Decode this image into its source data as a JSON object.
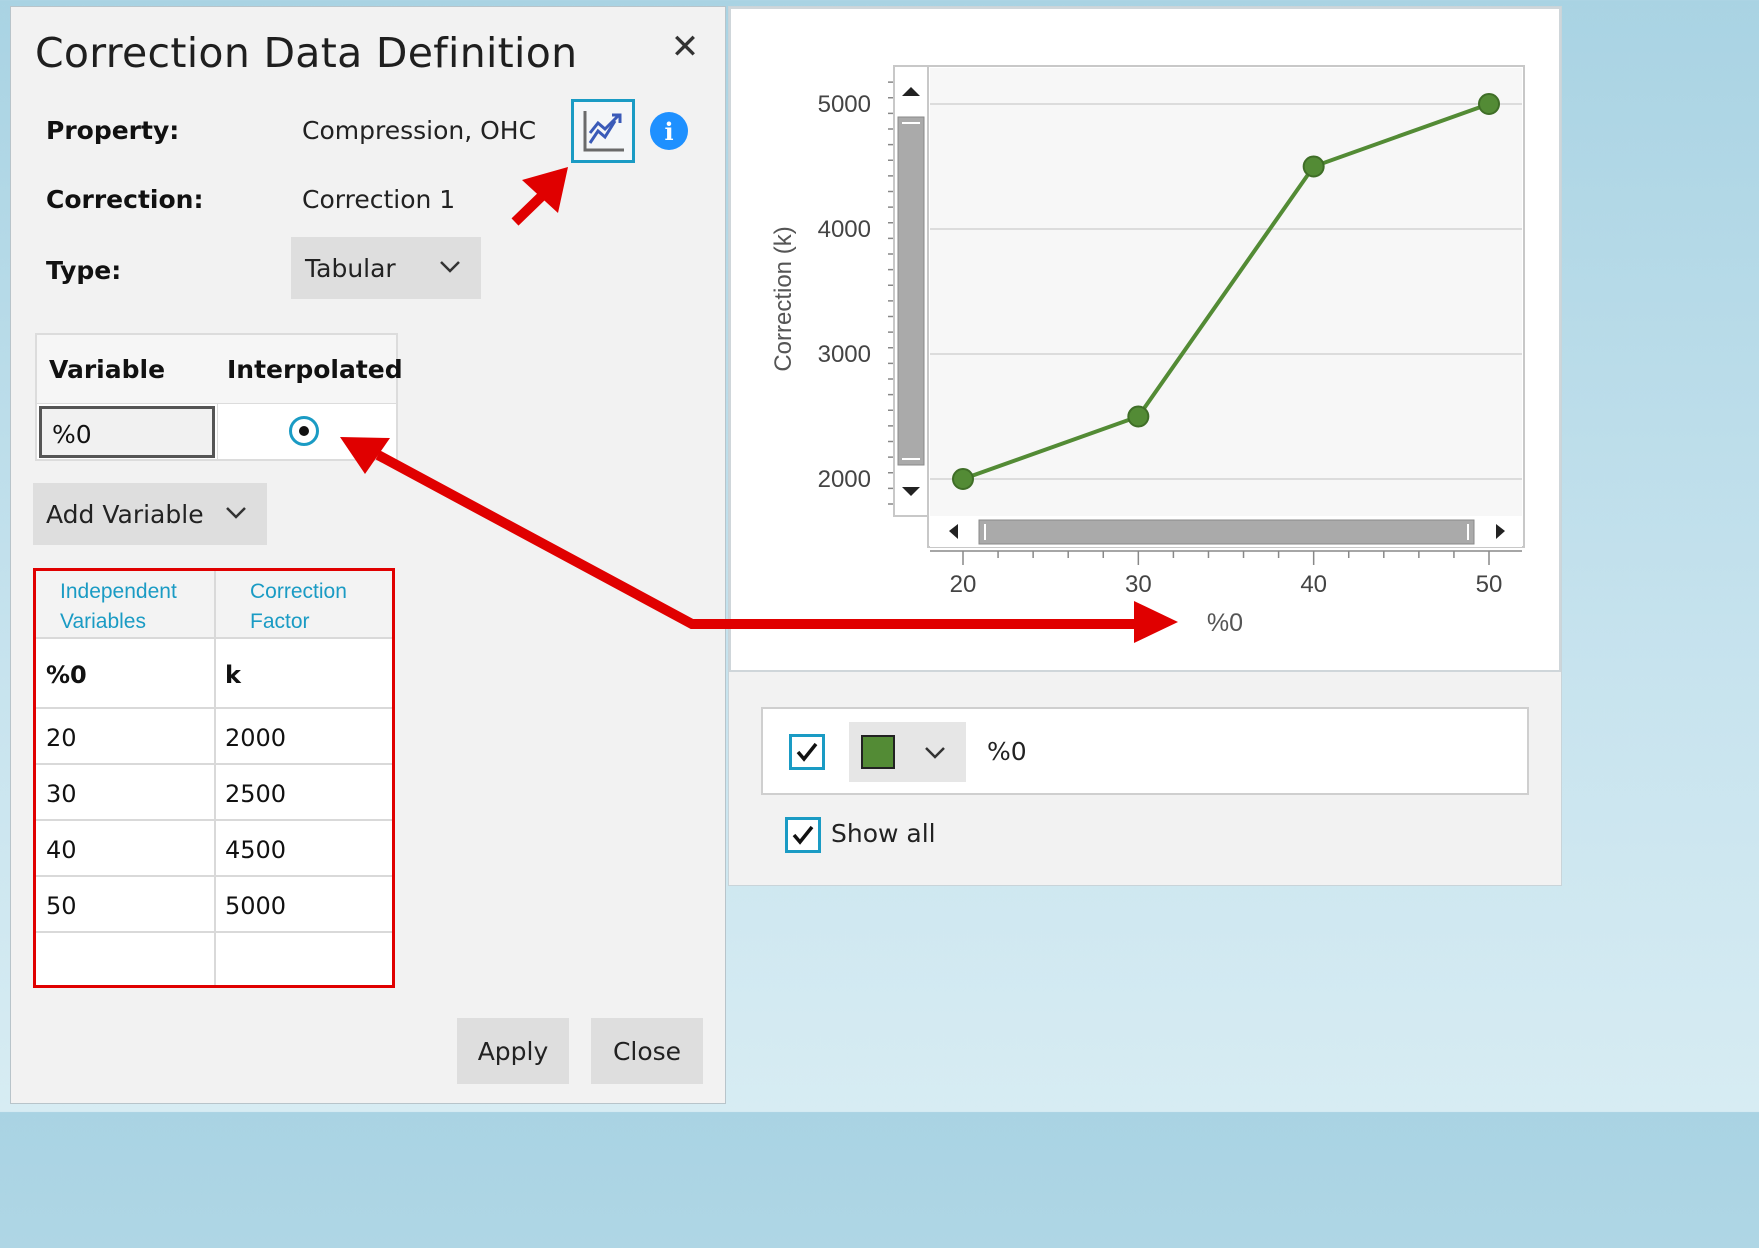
{
  "dialog": {
    "title": "Correction Data Definition",
    "close_glyph": "✕",
    "property_label": "Property:",
    "property_value": "Compression, OHC",
    "correction_label": "Correction:",
    "correction_value": "Correction 1",
    "type_label": "Type:",
    "type_value": "Tabular",
    "info_glyph": "i",
    "graph_icon": "line-chart-icon",
    "variable_table": {
      "headers": [
        "Variable",
        "Interpolated"
      ],
      "rows": [
        {
          "variable": "%0",
          "interpolated": true
        }
      ]
    },
    "add_variable_label": "Add Variable",
    "data_table": {
      "headers": [
        {
          "line1": "Independent",
          "line2": "Variables"
        },
        {
          "line1": "Correction",
          "line2": "Factor"
        }
      ],
      "subheader": [
        "%0",
        "k"
      ],
      "rows": [
        [
          "20",
          "2000"
        ],
        [
          "30",
          "2500"
        ],
        [
          "40",
          "4500"
        ],
        [
          "50",
          "5000"
        ],
        [
          "",
          ""
        ]
      ]
    },
    "apply_label": "Apply",
    "close_label": "Close"
  },
  "graph": {
    "legend": {
      "checked": true,
      "series_name": "%0",
      "color": "#538b35"
    },
    "show_all_label": "Show all",
    "show_all_checked": true
  },
  "colors": {
    "accent": "#1a9bc4",
    "series": "#538b35",
    "annotation": "#e00000"
  },
  "chart_data": {
    "type": "line",
    "title": "",
    "xlabel": "%0",
    "ylabel": "Correction (k)",
    "x": [
      20,
      30,
      40,
      50
    ],
    "series": [
      {
        "name": "%0",
        "values": [
          2000,
          2500,
          4500,
          5000
        ]
      }
    ],
    "x_ticks": [
      "20",
      "30",
      "40",
      "50"
    ],
    "y_ticks": [
      "2000",
      "3000",
      "4000",
      "5000"
    ],
    "xlim": [
      20,
      50
    ],
    "ylim": [
      2000,
      5000
    ],
    "grid": "horizontal"
  }
}
